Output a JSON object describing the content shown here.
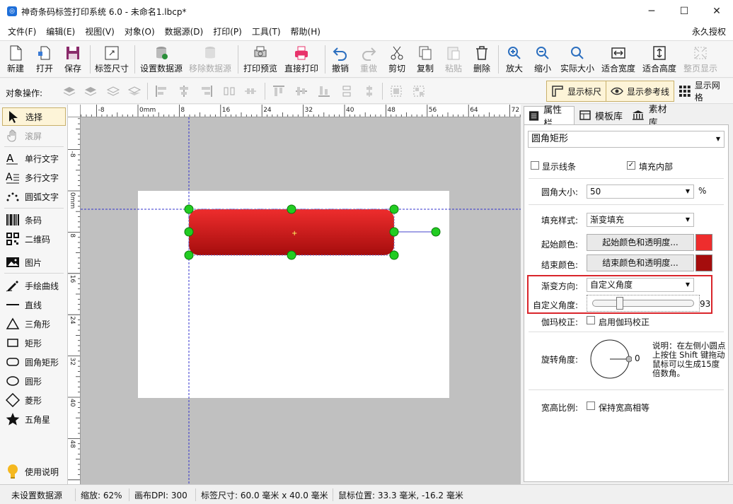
{
  "window": {
    "title": "神奇条码标签打印系统 6.0 - 未命名1.lbcp*",
    "minimize": "─",
    "maximize": "☐",
    "close": "✕"
  },
  "menu": {
    "items": [
      "文件(F)",
      "编辑(E)",
      "视图(V)",
      "对象(O)",
      "数据源(D)",
      "打印(P)",
      "工具(T)",
      "帮助(H)"
    ],
    "license": "永久授权"
  },
  "toolbar": {
    "new": "新建",
    "open": "打开",
    "save": "保存",
    "label_size": "标签尺寸",
    "set_datasource": "设置数据源",
    "remove_datasource": "移除数据源",
    "print_preview": "打印预览",
    "direct_print": "直接打印",
    "undo": "撤销",
    "redo": "重做",
    "cut": "剪切",
    "copy": "复制",
    "paste": "粘贴",
    "delete": "删除",
    "zoom_in": "放大",
    "zoom_out": "缩小",
    "actual_size": "实际大小",
    "fit_width": "适合宽度",
    "fit_height": "适合高度",
    "fit_page": "整页显示"
  },
  "objbar": {
    "label": "对象操作:",
    "show_ruler": "显示标尺",
    "show_guides": "显示参考线",
    "show_grid": "显示网格"
  },
  "tools": {
    "select": "选择",
    "scroll": "滚屏",
    "single_text": "单行文字",
    "multi_text": "多行文字",
    "arc_text": "圆弧文字",
    "barcode": "条码",
    "qrcode": "二维码",
    "image": "图片",
    "freehand": "手绘曲线",
    "line": "直线",
    "triangle": "三角形",
    "rect": "矩形",
    "round_rect": "圆角矩形",
    "ellipse": "圆形",
    "diamond": "菱形",
    "star": "五角星",
    "help": "使用说明"
  },
  "ruler": {
    "unit": "mm",
    "h_ticks": [
      "-8",
      "0mm",
      "8",
      "16",
      "24",
      "32",
      "40",
      "48",
      "56",
      "64",
      "72"
    ],
    "v_ticks": [
      "-8",
      "0mm",
      "8",
      "16",
      "24",
      "32",
      "40",
      "48"
    ]
  },
  "panel": {
    "tabs": [
      "属性栏",
      "模板库",
      "素材库"
    ],
    "object_type": "圆角矩形",
    "show_border": "显示线条",
    "fill_inside": "填充内部",
    "corner_size_label": "圆角大小:",
    "corner_size_value": "50",
    "corner_size_unit": "%",
    "fill_style_label": "填充样式:",
    "fill_style_value": "渐变填充",
    "start_color_label": "起始颜色:",
    "start_color_button": "起始颜色和透明度...",
    "end_color_label": "结束颜色:",
    "end_color_button": "结束颜色和透明度...",
    "gradient_dir_label": "渐变方向:",
    "gradient_dir_value": "自定义角度",
    "custom_angle_label": "自定义角度:",
    "custom_angle_value": "93",
    "gamma_label": "伽玛校正:",
    "gamma_checkbox": "启用伽玛校正",
    "rotation_label": "旋转角度:",
    "rotation_value": "0",
    "rotation_note": "说明：在左侧小圆点上按住 Shift 键拖动鼠标可以生成15度倍数角。",
    "aspect_label": "宽高比例:",
    "aspect_checkbox": "保持宽高相等"
  },
  "colors": {
    "start": "#ee2d2d",
    "end": "#a50d0d",
    "highlight_border": "#d9252b",
    "handle": "#22cc22",
    "guide": "#3333cc"
  },
  "status": {
    "datasource": "未设置数据源",
    "zoom": "缩放: 62%",
    "dpi": "画布DPI: 300",
    "label_size": "标签尺寸: 60.0 毫米 x 40.0 毫米",
    "mouse_pos": "鼠标位置: 33.3 毫米, -16.2 毫米"
  }
}
